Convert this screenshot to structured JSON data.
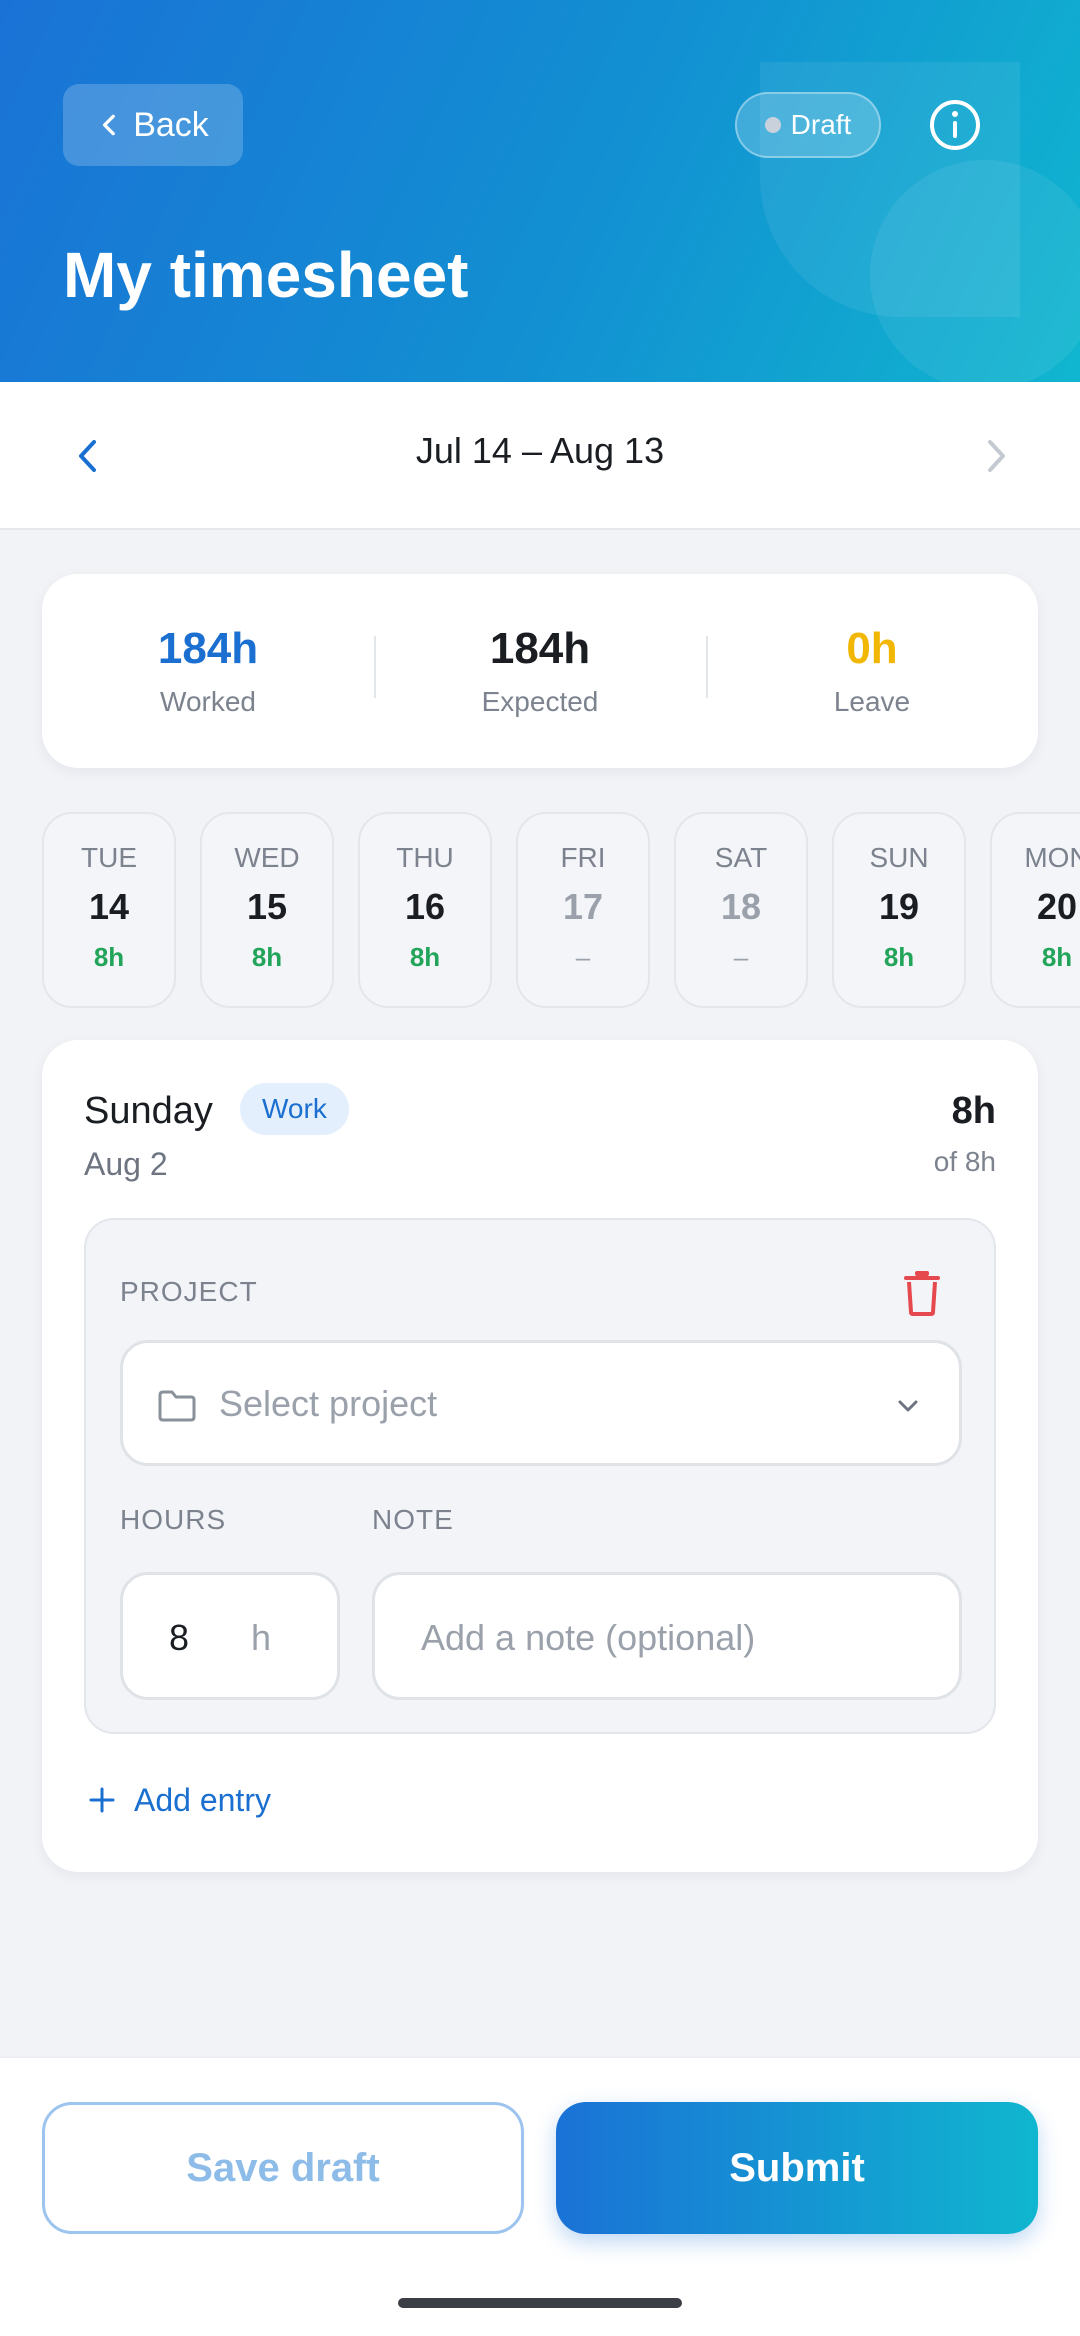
{
  "header": {
    "back_label": "Back",
    "status_label": "Draft",
    "title": "My timesheet",
    "icons": {
      "back": "chevron-left-icon",
      "info": "info-icon"
    }
  },
  "period": {
    "label": "Jul 14 – Aug 13",
    "icons": {
      "prev": "chevron-left-icon",
      "next": "chevron-right-icon"
    }
  },
  "summary": {
    "worked": {
      "value": "184h",
      "label": "Worked",
      "color": "#1a6fd0"
    },
    "expected": {
      "value": "184h",
      "label": "Expected",
      "color": "#1a1d22"
    },
    "leave": {
      "value": "0h",
      "label": "Leave",
      "color": "#f2b705"
    }
  },
  "days": [
    {
      "weekday": "TUE",
      "num": "14",
      "hours": "8h",
      "off": false
    },
    {
      "weekday": "WED",
      "num": "15",
      "hours": "8h",
      "off": false
    },
    {
      "weekday": "THU",
      "num": "16",
      "hours": "8h",
      "off": false
    },
    {
      "weekday": "FRI",
      "num": "17",
      "hours": "–",
      "off": true
    },
    {
      "weekday": "SAT",
      "num": "18",
      "hours": "–",
      "off": true
    },
    {
      "weekday": "SUN",
      "num": "19",
      "hours": "8h",
      "off": false
    },
    {
      "weekday": "MON",
      "num": "20",
      "hours": "8h",
      "off": false
    }
  ],
  "detail": {
    "day_name": "Sunday",
    "type_badge": "Work",
    "date": "Aug 2",
    "hours": "8h",
    "of_hours": "of 8h",
    "entry": {
      "project_label": "PROJECT",
      "project_placeholder": "Select project",
      "hours_label": "HOURS",
      "hours_value": "8",
      "hours_unit": "h",
      "note_label": "NOTE",
      "note_placeholder": "Add a note (optional)",
      "icons": {
        "delete": "trash-icon",
        "folder": "folder-icon",
        "dropdown": "chevron-down-icon"
      }
    },
    "add_entry_label": "Add entry"
  },
  "actions": {
    "save_draft_label": "Save draft",
    "submit_label": "Submit"
  },
  "colors": {
    "accent": "#1a72d6",
    "accent_end": "#10b6cf",
    "success": "#22a55a",
    "warning": "#f2b705",
    "danger": "#e5484d"
  }
}
